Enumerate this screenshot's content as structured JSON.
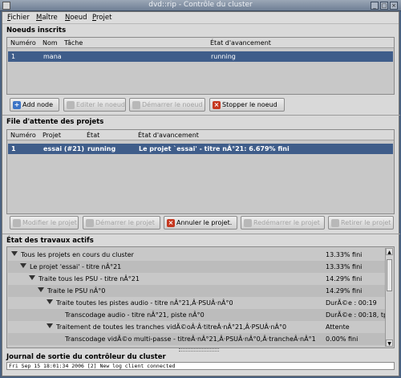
{
  "window": {
    "title": "dvd::rip - Contrôle du cluster"
  },
  "menubar": [
    {
      "accel": "F",
      "rest": "ichier"
    },
    {
      "accel": "M",
      "rest": "aître"
    },
    {
      "accel": "N",
      "rest": "oeud"
    },
    {
      "accel": "P",
      "rest": "rojet"
    }
  ],
  "nodes": {
    "title": "Noeuds inscrits",
    "columns": [
      "Numéro",
      "Nom",
      "Tâche",
      "État d'avancement"
    ],
    "rows": [
      {
        "num": "1",
        "name": "mana",
        "task": "",
        "status": "running"
      }
    ],
    "buttons": {
      "add": "Add node",
      "edit": "Editer le noeud",
      "start": "Démarrer le noeud",
      "stop": "Stopper le noeud"
    }
  },
  "queue": {
    "title": "File d'attente des projets",
    "columns": [
      "Numéro",
      "Projet",
      "État",
      "État d'avancement"
    ],
    "rows": [
      {
        "num": "1",
        "project": "essai (#21)",
        "state": "running",
        "progress": "Le projet `essai' - titre nÂ°21: 6.679% fini"
      }
    ],
    "buttons": {
      "edit": "Modifier le projet",
      "start": "Démarrer le projet",
      "cancel": "Annuler le projet.",
      "restart": "Redémarrer le projet",
      "pause": "Retirer le projet"
    }
  },
  "jobs": {
    "title": "État des travaux actifs",
    "rows": [
      {
        "label": "Tous les projets en cours du cluster",
        "status": "13.33% fini"
      },
      {
        "label": "Le projet 'essai' - titre nÂ°21",
        "status": "13.33% fini"
      },
      {
        "label": "Traite tous les PSU - titre nÂ°21",
        "status": "14.29% fini"
      },
      {
        "label": "Traite le PSU nÂ°0",
        "status": "14.29% fini"
      },
      {
        "label": "Traite toutes les pistes audio - titre nÂ°21,Â·PSUÂ·nÂ°0",
        "status": "DurÃ©e : 00:19"
      },
      {
        "label": "Transcodage audio - titre nÂ°21, piste nÂ°0",
        "status": "DurÃ©e : 00:18, tp"
      },
      {
        "label": "Traitement de toutes les tranches vidÃ©oÂ·Â·titreÂ·nÂ°21,Â·PSUÂ·nÂ°0",
        "status": "Attente"
      },
      {
        "label": "Transcodage vidÃ©o multi-passe - titreÂ·nÂ°21,Â·PSUÂ·nÂ°0,Â·trancheÂ·nÂ°1",
        "status": "0.00% fini"
      }
    ]
  },
  "log": {
    "title": "Journal de sortie du contrôleur du cluster",
    "line": "Fri Sep 15 18:01:34 2006 [2] New log client connected"
  }
}
